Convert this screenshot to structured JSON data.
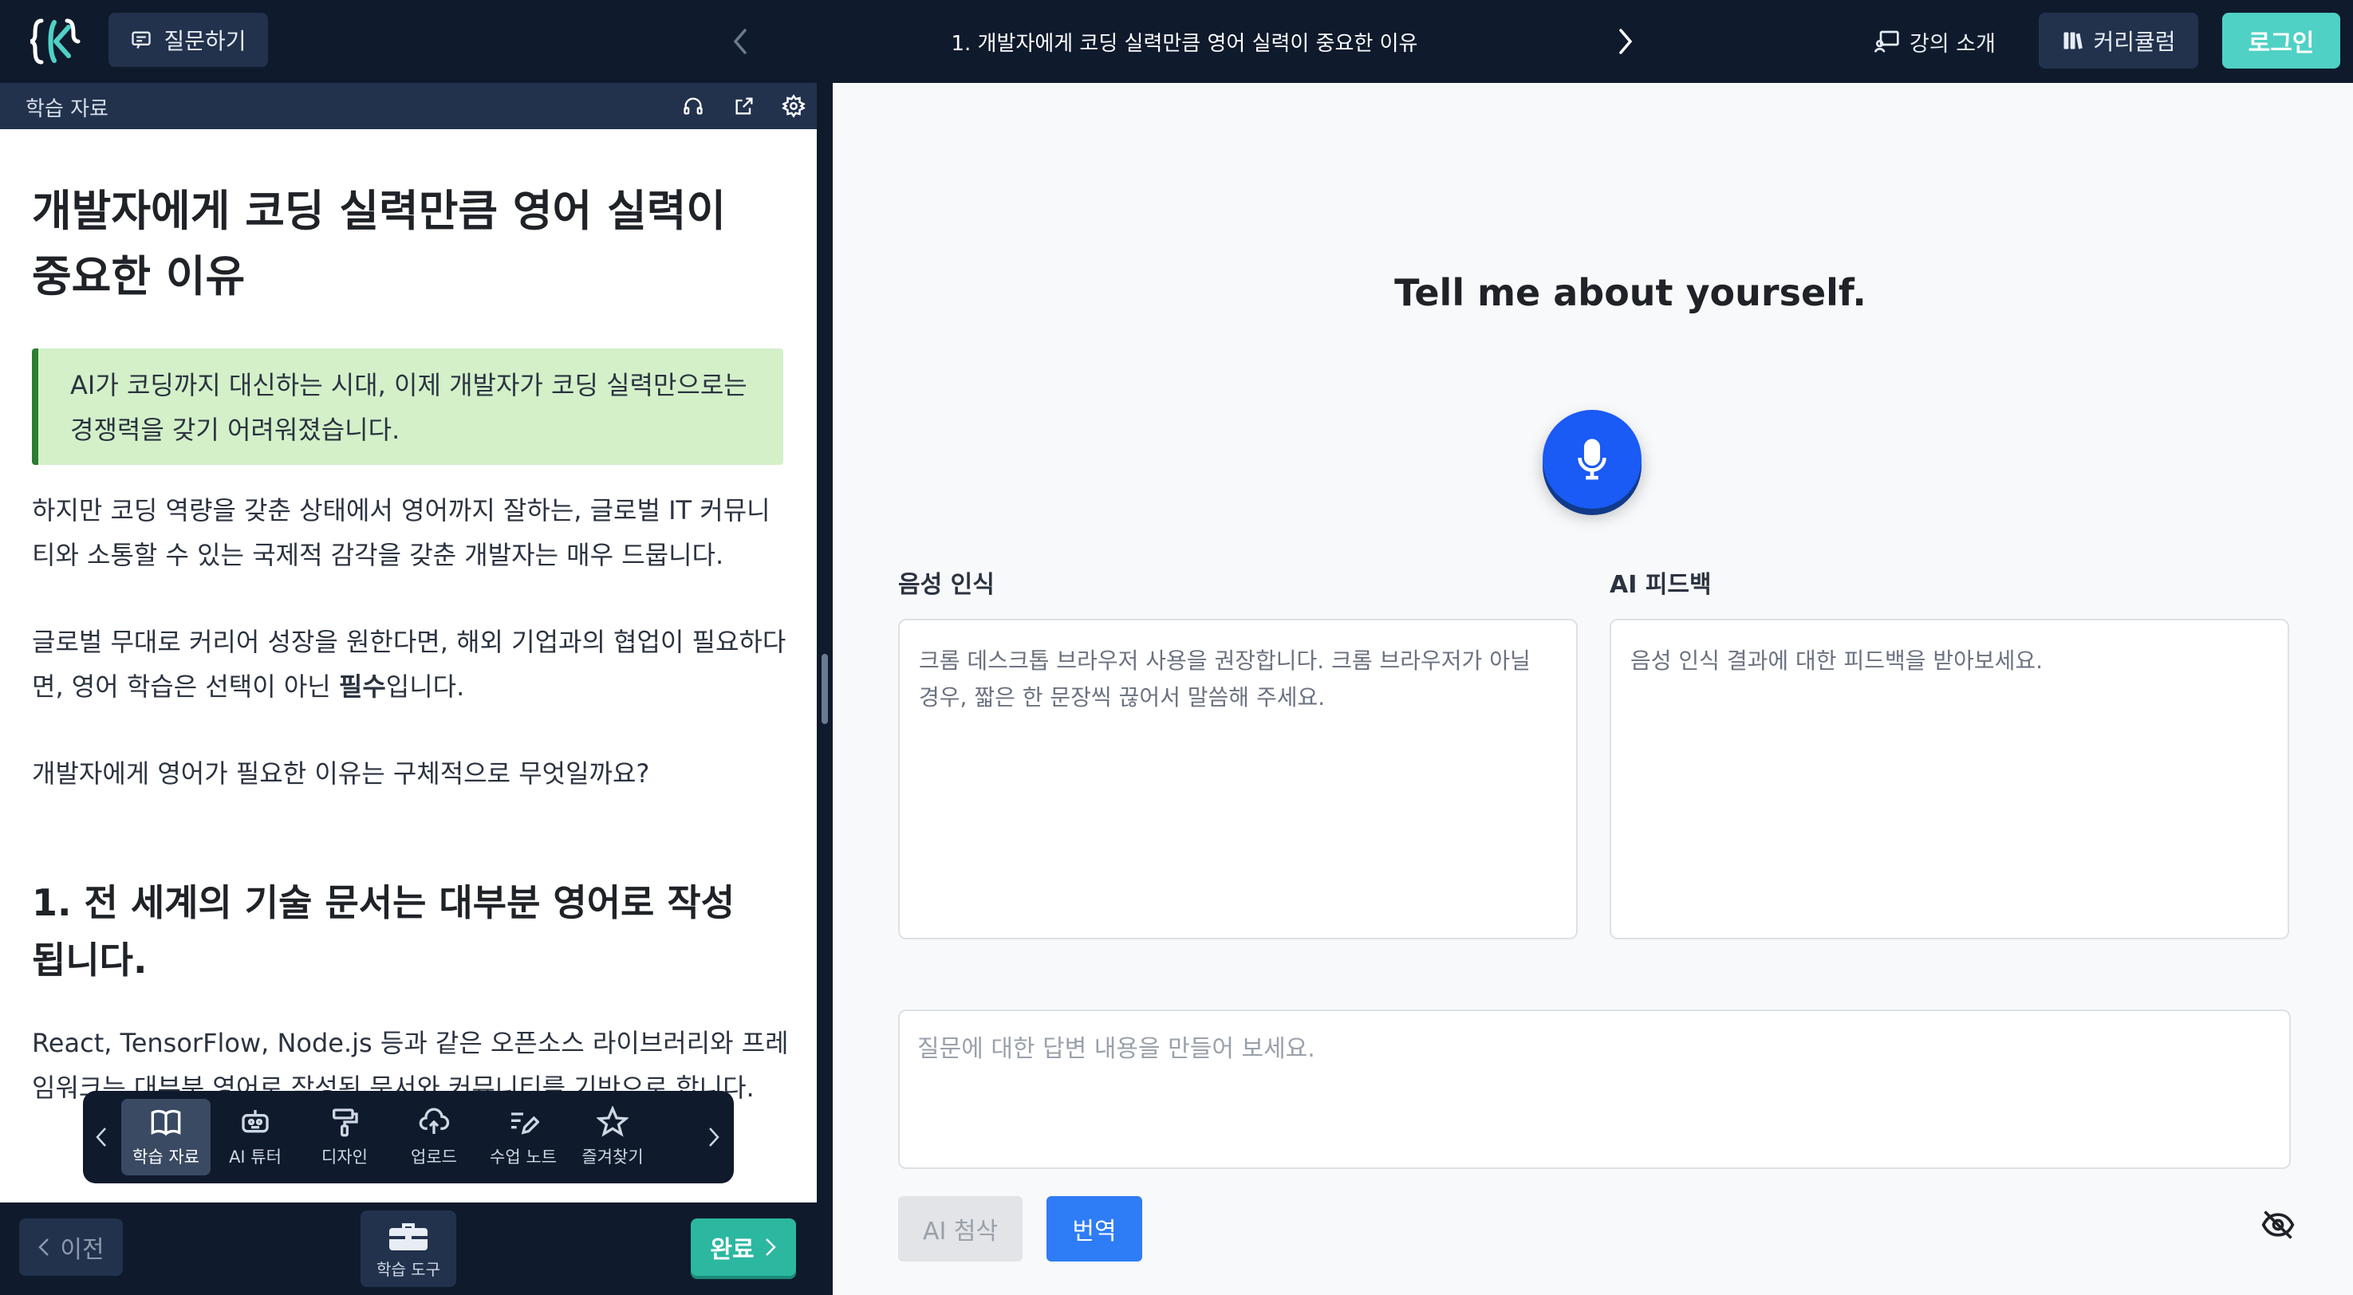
{
  "topbar": {
    "ask_label": "질문하기",
    "lesson_title": "1. 개발자에게 코딩 실력만큼 영어 실력이 중요한 이유",
    "intro_label": "강의 소개",
    "curriculum_label": "커리큘럼",
    "login_label": "로그인"
  },
  "left": {
    "header_title": "학습 자료",
    "h1": "개발자에게 코딩 실력만큼 영어 실력이 중요한 이유",
    "callout": "AI가 코딩까지 대신하는 시대, 이제 개발자가 코딩 실력만으로는 경쟁력을 갖기 어려워졌습니다.",
    "p1": "하지만 코딩 역량을 갖춘 상태에서 영어까지 잘하는, 글로벌 IT 커뮤니티와 소통할 수 있는 국제적 감각을 갖춘 개발자는 매우 드뭅니다.",
    "p2_a": "글로벌 무대로 커리어 성장을 원한다면, 해외 기업과의 협업이 필요하다면, 영어 학습은 선택이 아닌 ",
    "p2_bold": "필수",
    "p2_b": "입니다.",
    "p3": "개발자에게 영어가 필요한 이유는 구체적으로 무엇일까요?",
    "h2": "1. 전 세계의 기술 문서는 대부분 영어로 작성됩니다.",
    "p4": "React, TensorFlow, Node.js 등과 같은 오픈소스 라이브러리와 프레임워크는 대부분 영어로 작성된 문서와 커뮤니티를 기반으로 합니다."
  },
  "toolbar": {
    "items": [
      {
        "label": "학습 자료",
        "icon": "book-icon"
      },
      {
        "label": "AI 튜터",
        "icon": "robot-icon"
      },
      {
        "label": "디자인",
        "icon": "paint-roller-icon"
      },
      {
        "label": "업로드",
        "icon": "cloud-upload-icon"
      },
      {
        "label": "수업 노트",
        "icon": "note-pen-icon"
      },
      {
        "label": "즐겨찾기",
        "icon": "star-icon"
      }
    ]
  },
  "bottom": {
    "prev_label": "이전",
    "tools_label": "학습 도구",
    "done_label": "완료"
  },
  "right": {
    "question": "Tell me about yourself.",
    "speech_label": "음성 인식",
    "feedback_label": "AI 피드백",
    "speech_placeholder": "크롬 데스크톱 브라우저 사용을 권장합니다. 크롬 브라우저가 아닐 경우, 짧은 한 문장씩 끊어서 말씀해 주세요.",
    "feedback_placeholder": "음성 인식 결과에 대한 피드백을 받아보세요.",
    "answer_placeholder": "질문에 대한 답변 내용을 만들어 보세요.",
    "ai_review_label": "AI 첨삭",
    "translate_label": "번역"
  },
  "colors": {
    "topbar": "#0f1a2c",
    "accent_teal": "#4fd1c5",
    "mic_blue": "#1a5af5",
    "translate_blue": "#2e7cf6",
    "callout_bg": "#d3f0c9",
    "callout_border": "#2e7d32"
  }
}
